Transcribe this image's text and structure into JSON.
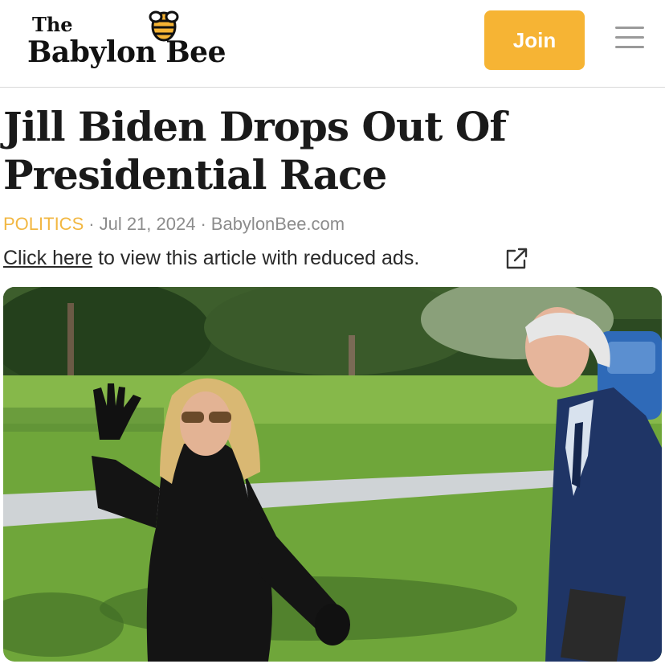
{
  "header": {
    "logo_the": "The",
    "logo_main": "Babylon Bee",
    "join_label": "Join",
    "accent_color": "#f6b434",
    "icons": [
      "bee-icon",
      "menu-icon"
    ]
  },
  "article": {
    "headline": "Jill Biden Drops Out Of Presidential Race",
    "category": "POLITICS",
    "date": "Jul 21, 2024",
    "source": "BabylonBee.com",
    "separator": "·",
    "reduced_ads_link": "Click here",
    "reduced_ads_text": " to view this article with reduced ads.",
    "external_icon": "external-link-icon",
    "category_color": "#f2b741"
  },
  "photo": {
    "description_icon": "article-photo"
  }
}
